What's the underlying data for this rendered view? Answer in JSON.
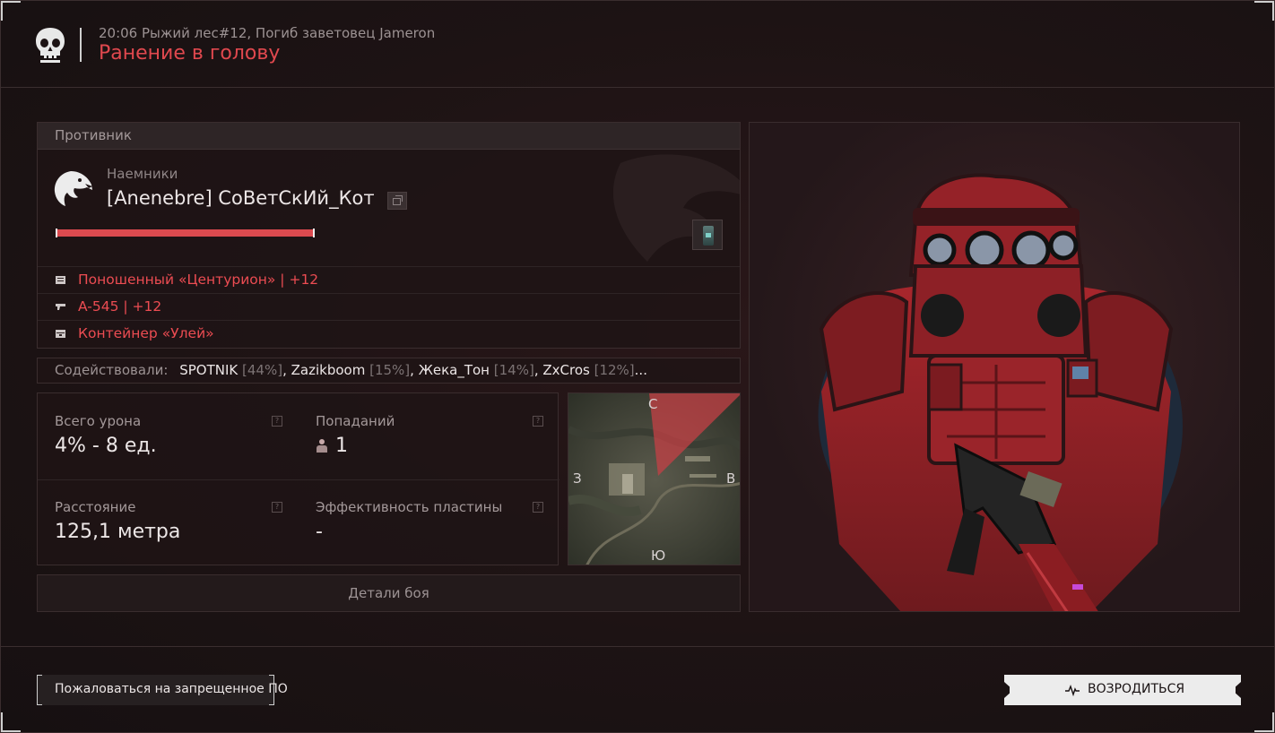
{
  "header": {
    "subtitle": "20:06 Рыжий лес#12, Погиб заветовец Jameron",
    "title": "Ранение в голову"
  },
  "enemy": {
    "section_label": "Противник",
    "faction": "Наемники",
    "player_name": "[Anenebre] СоВетСкИй_Кот",
    "health_fraction": 1.0,
    "equipment": [
      {
        "icon": "armor-icon",
        "text": "Поношенный «Центурион» | +12"
      },
      {
        "icon": "rifle-icon",
        "text": "A-545 | +12"
      },
      {
        "icon": "container-icon",
        "text": "Контейнер «Улей»"
      }
    ]
  },
  "assists": {
    "label": "Содействовали:",
    "players": [
      {
        "name": "SPOTNIK",
        "pct": "[44%]",
        "sep": ", "
      },
      {
        "name": "Zazikboom",
        "pct": "[15%]",
        "sep": ", "
      },
      {
        "name": "Жека_Тон",
        "pct": "[14%]",
        "sep": ", "
      },
      {
        "name": "ZxCros",
        "pct": "[12%]",
        "sep": "..."
      }
    ]
  },
  "stats": {
    "damage_label": "Всего урона",
    "damage_value": "4% - 8 ед.",
    "hits_label": "Попаданий",
    "hits_value": "1",
    "distance_label": "Расстояние",
    "distance_value": "125,1 метра",
    "plate_label": "Эффективность пластины",
    "plate_value": "-",
    "help_glyph": "?"
  },
  "minimap": {
    "north": "С",
    "south": "Ю",
    "west": "З",
    "east": "В"
  },
  "details_button": "Детали боя",
  "report_button": "Пожаловаться на запрещенное ПО",
  "respawn_button": "ВОЗРОДИТЬСЯ",
  "colors": {
    "accent_red": "#e0484e",
    "background": "#1a1112",
    "button_light": "#ececec"
  }
}
